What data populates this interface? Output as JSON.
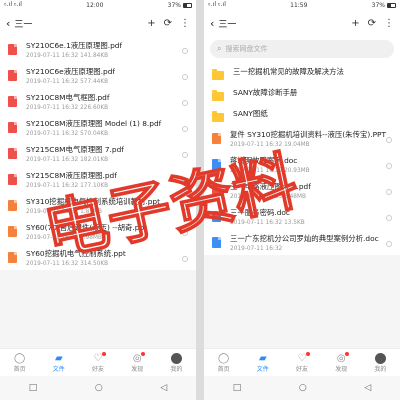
{
  "left": {
    "status": {
      "time": "12:00",
      "signal": "᭝.ıl ᭝.ıl",
      "battery": "37%"
    },
    "header": {
      "back": "‹",
      "title": "三一",
      "icons": [
        "+",
        "⟳",
        "⋮"
      ]
    },
    "files": [
      {
        "type": "pdf",
        "name": "SY210C6e.1液压原理图.pdf",
        "meta": "2019-07-11  16:32  141.84KB"
      },
      {
        "type": "pdf",
        "name": "SY210C6e液压原理图.pdf",
        "meta": "2019-07-11  16:32  577.44KB"
      },
      {
        "type": "pdf",
        "name": "SY210C8M电气框图.pdf",
        "meta": "2019-07-11  16:32  226.60KB"
      },
      {
        "type": "pdf",
        "name": "SY210C8M液压原理图 Model (1)  8.pdf",
        "meta": "2019-07-11  16:32  570.04KB"
      },
      {
        "type": "pdf",
        "name": "SY215C8M电气原理图  7.pdf",
        "meta": "2019-07-11  16:32  182.01KB"
      },
      {
        "type": "pdf",
        "name": "SY215C8M液压原理图.pdf",
        "meta": "2019-07-11  16:32  177.10KB"
      },
      {
        "type": "ppt",
        "name": "SY310挖掘机电气控制系统培训教材.ppt",
        "meta": "2019-07-11  16:32  1.87MB"
      },
      {
        "type": "ppt",
        "name": "SY60(70)售后课件(液压)  --胡奇.ppt",
        "meta": "2019-07-11  16:32  4.98MB"
      },
      {
        "type": "ppt",
        "name": "SY60挖掘机电气控制系统.ppt",
        "meta": "2019-07-11  16:32  314.50KB"
      }
    ],
    "tabs": [
      {
        "icon": "◯",
        "label": "首页",
        "active": false,
        "dot": false
      },
      {
        "icon": "▰",
        "label": "文件",
        "active": true,
        "dot": false
      },
      {
        "icon": "♡",
        "label": "好友",
        "active": false,
        "dot": true
      },
      {
        "icon": "◎",
        "label": "发现",
        "active": false,
        "dot": true
      },
      {
        "icon": "●",
        "label": "我的",
        "active": false,
        "dot": false
      }
    ],
    "nav": [
      "□",
      "○",
      "◁"
    ]
  },
  "right": {
    "status": {
      "time": "11:59",
      "signal": "᭝.ıl ᭝.ıl",
      "battery": "37%"
    },
    "header": {
      "back": "‹",
      "title": "三一",
      "icons": [
        "+",
        "⟳",
        "⋮"
      ]
    },
    "search_placeholder": "搜索网盘文件",
    "files": [
      {
        "type": "folder",
        "name": "三一挖掘机常见的故障及解决方法",
        "meta": ""
      },
      {
        "type": "folder",
        "name": "SANY故障诊断手册",
        "meta": ""
      },
      {
        "type": "folder",
        "name": "SANY图纸",
        "meta": ""
      },
      {
        "type": "ppt",
        "name": "复件 SY310挖掘机培训资料--液压(朱传宝).PPT",
        "meta": "2019-07-11  16:32  19.04MB"
      },
      {
        "type": "doc",
        "name": "蒋增明故障案例.doc",
        "meta": "2019-07-11  16:32  20.93MB"
      },
      {
        "type": "pdf",
        "name": "三一电路液压图大全.pdf",
        "meta": "2019-09-08  10:55  6.48MB"
      },
      {
        "type": "doc",
        "name": "三一服务密码.doc",
        "meta": "2019-07-11  16:32  13.5KB"
      },
      {
        "type": "doc",
        "name": "三一广东挖机分公司罗灿的典型案例分析.doc",
        "meta": "2019-07-11  16:32"
      }
    ],
    "tabs": [
      {
        "icon": "◯",
        "label": "首页",
        "active": false,
        "dot": false
      },
      {
        "icon": "▰",
        "label": "文件",
        "active": true,
        "dot": false
      },
      {
        "icon": "♡",
        "label": "好友",
        "active": false,
        "dot": true
      },
      {
        "icon": "◎",
        "label": "发现",
        "active": false,
        "dot": true
      },
      {
        "icon": "●",
        "label": "我的",
        "active": false,
        "dot": false
      }
    ],
    "nav": [
      "□",
      "○",
      "◁"
    ]
  },
  "watermark": {
    "text": "电子资料",
    "color": "#e23a2a"
  }
}
